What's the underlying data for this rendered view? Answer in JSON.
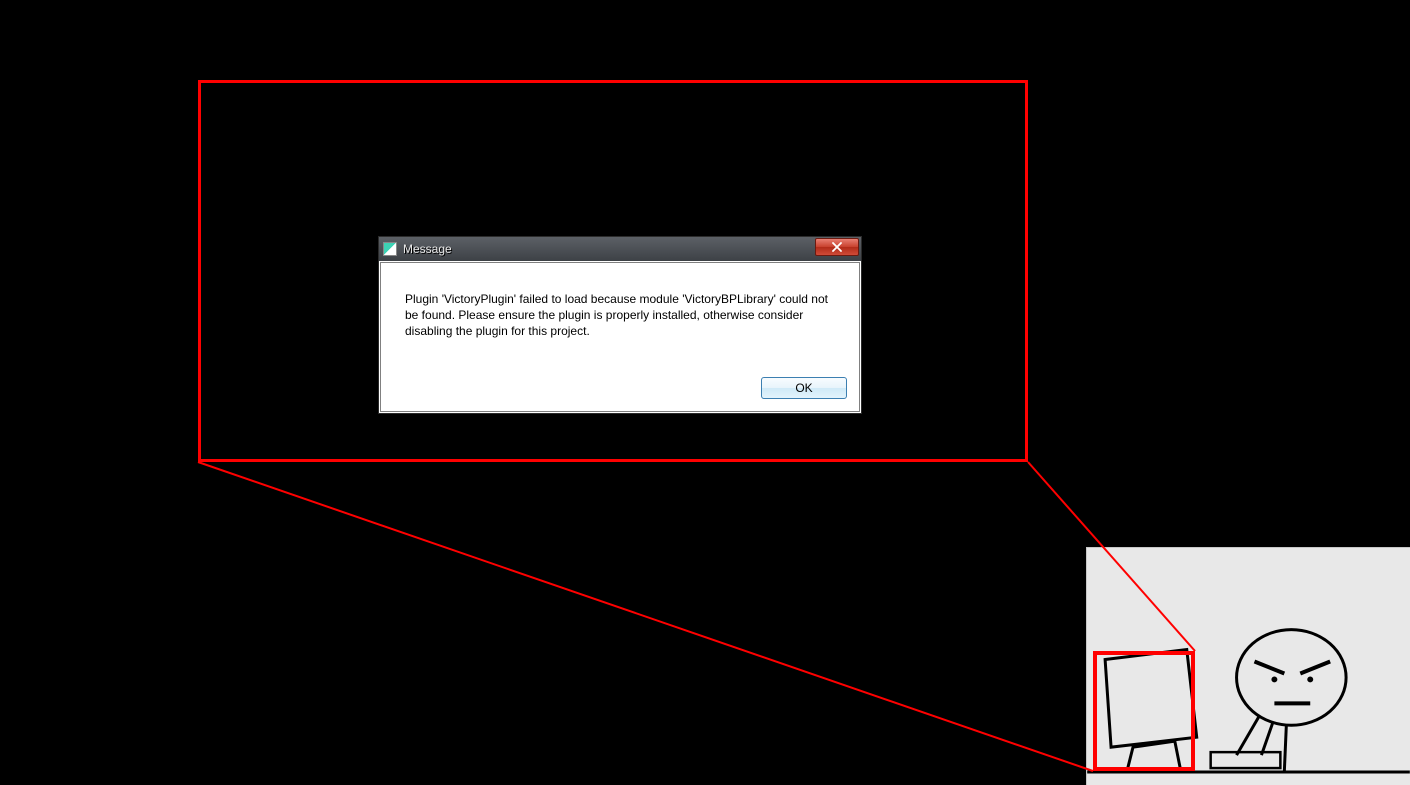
{
  "dialog": {
    "title": "Message",
    "body_text": "Plugin 'VictoryPlugin' failed to load because module 'VictoryBPLibrary' could not be found.  Please ensure the plugin is properly installed, otherwise consider disabling the plugin for this project.",
    "ok_label": "OK"
  },
  "annotation": {
    "color": "#ff0000"
  }
}
